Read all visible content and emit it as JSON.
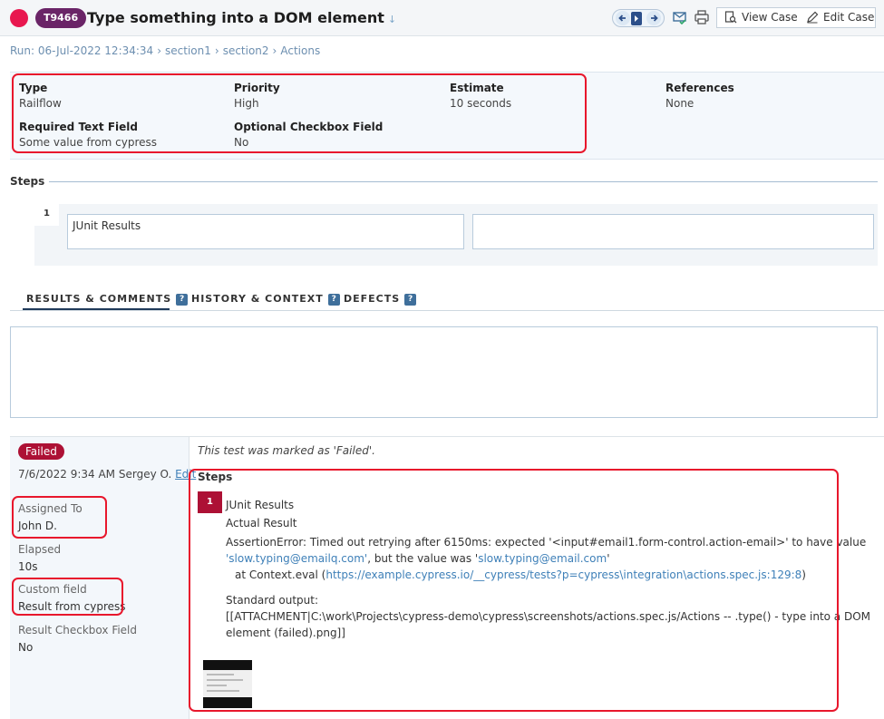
{
  "header": {
    "case_id": "T9466",
    "title": "Type something into a DOM element",
    "title_caret": "↓",
    "view_case_label": "View Case",
    "edit_case_label": "Edit Case",
    "status_color": "#e8174f",
    "case_id_color": "#6a2467"
  },
  "breadcrumb": {
    "run": "Run: 06-Jul-2022 12:34:34",
    "section1": "section1",
    "section2": "section2",
    "current": "Actions",
    "separator": "›"
  },
  "fields": {
    "type": {
      "label": "Type",
      "value": "Railflow"
    },
    "priority": {
      "label": "Priority",
      "value": "High"
    },
    "estimate": {
      "label": "Estimate",
      "value": "10 seconds"
    },
    "references": {
      "label": "References",
      "value": "None"
    },
    "required_text": {
      "label": "Required Text Field",
      "value": "Some value from cypress"
    },
    "optional_checkbox": {
      "label": "Optional Checkbox Field",
      "value": "No"
    }
  },
  "steps": {
    "heading": "Steps",
    "items": [
      {
        "number": "1",
        "content": "JUnit Results",
        "expected": ""
      }
    ]
  },
  "tabs": [
    {
      "label": "RESULTS & COMMENTS",
      "help": "?"
    },
    {
      "label": "HISTORY & CONTEXT",
      "help": "?"
    },
    {
      "label": "DEFECTS",
      "help": "?"
    }
  ],
  "result": {
    "status": "Failed",
    "status_color": "#ad1135",
    "meta": "7/6/2022 9:34 AM Sergey O.",
    "edit_link": "Edit",
    "assigned_label": "Assigned To",
    "assigned_value": "John D.",
    "elapsed_label": "Elapsed",
    "elapsed_value": "10s",
    "custom_label": "Custom field",
    "custom_value": "Result from cypress",
    "checkbox_label": "Result Checkbox Field",
    "checkbox_value": "No",
    "marked_note": "This test was marked as 'Failed'.",
    "steps_label": "Steps",
    "step_number": "1",
    "step_title": "JUnit Results",
    "actual_result_label": "Actual Result",
    "error_prefix": "AssertionError: Timed out retrying after 6150ms: expected '<input#email1.form-control.action-email>' to have value",
    "error_expected": "'slow.typing@emailq.com'",
    "error_mid": ", but the value was '",
    "error_actual": "slow.typing@email.com",
    "error_suffix": "'",
    "trace_prefix": "at Context.eval (",
    "trace_link": "https://example.cypress.io/__cypress/tests?p=cypress\\integration\\actions.spec.js:129:8",
    "trace_suffix": ")",
    "stdout_label": "Standard output:",
    "stdout_line1": "[[ATTACHMENT|C:\\work\\Projects\\cypress-demo\\cypress\\screenshots/actions.spec.js/Actions -- .type() - type into a DOM",
    "stdout_line2": "element (failed).png]]"
  }
}
